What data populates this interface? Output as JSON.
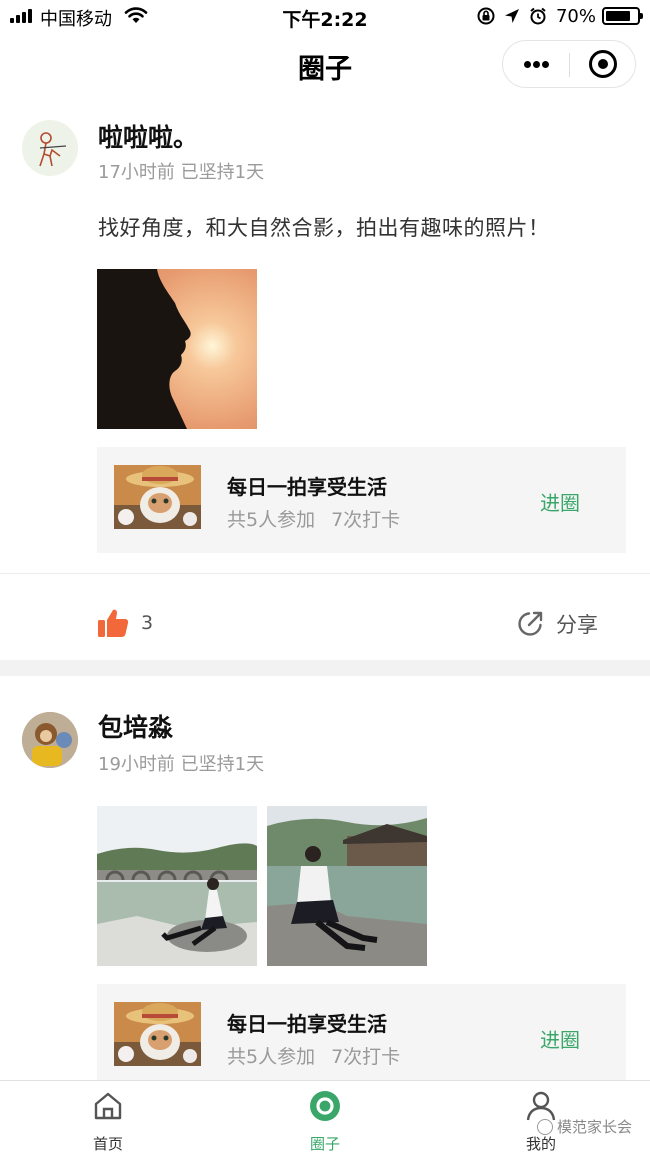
{
  "status_bar": {
    "carrier": "中国移动",
    "time": "下午2:22",
    "battery_percent": "70%",
    "battery_level": 0.7
  },
  "nav": {
    "title": "圈子"
  },
  "posts": [
    {
      "author": "啦啦啦。",
      "time_ago": "17小时前",
      "streak": "已坚持1天",
      "content": "找好角度，和大自然合影，拍出有趣味的照片！",
      "circle": {
        "name": "每日一拍享受生活",
        "participants": "共5人参加",
        "checkins": "7次打卡",
        "join_label": "进圈"
      },
      "like_count": "3",
      "share_label": "分享"
    },
    {
      "author": "包培淼",
      "time_ago": "19小时前",
      "streak": "已坚持1天",
      "circle": {
        "name": "每日一拍享受生活",
        "participants": "共5人参加",
        "checkins": "7次打卡",
        "join_label": "进圈"
      }
    }
  ],
  "tabs": [
    {
      "label": "首页",
      "icon": "home-icon"
    },
    {
      "label": "圈子",
      "icon": "circle-icon",
      "active": true
    },
    {
      "label": "我的",
      "icon": "user-icon"
    }
  ],
  "watermark": "模范家长会",
  "colors": {
    "accent_green": "#3aa66a",
    "like_orange": "#f2683a"
  }
}
